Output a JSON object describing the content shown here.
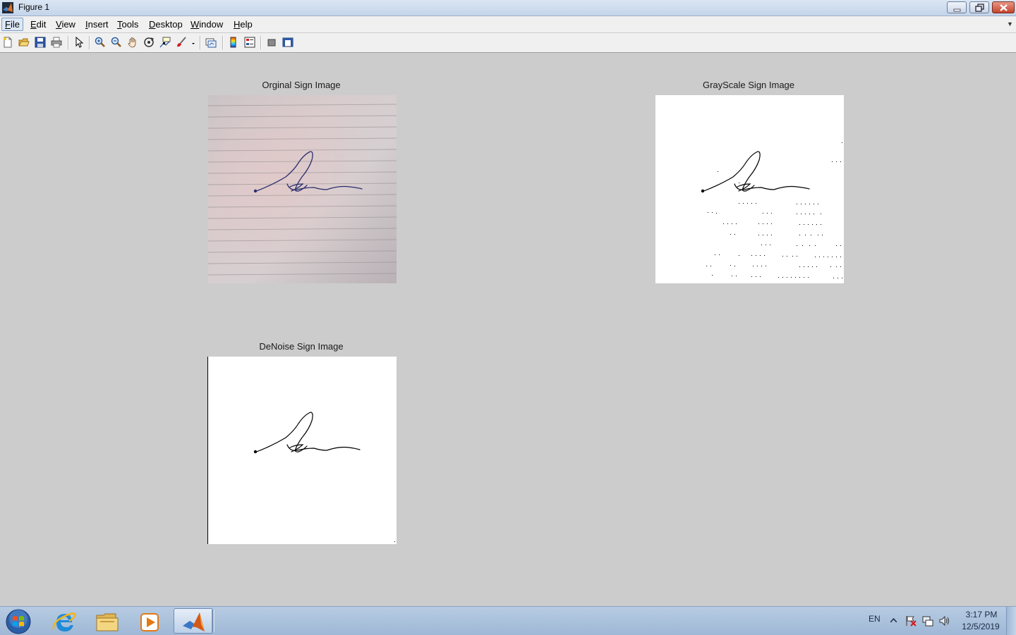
{
  "window": {
    "title": "Figure 1"
  },
  "menu": [
    {
      "label": "File",
      "ul": "F",
      "rest": "ile"
    },
    {
      "label": "Edit",
      "ul": "E",
      "rest": "dit"
    },
    {
      "label": "View",
      "ul": "V",
      "rest": "iew"
    },
    {
      "label": "Insert",
      "ul": "I",
      "rest": "nsert"
    },
    {
      "label": "Tools",
      "ul": "T",
      "rest": "ools"
    },
    {
      "label": "Desktop",
      "ul": "D",
      "rest": "esktop"
    },
    {
      "label": "Window",
      "ul": "W",
      "rest": "indow"
    },
    {
      "label": "Help",
      "ul": "H",
      "rest": "elp"
    }
  ],
  "toolbar": [
    "new-figure-icon",
    "open-file-icon",
    "save-icon",
    "print-icon",
    "edit-plot-arrow-icon",
    "zoom-in-icon",
    "zoom-out-icon",
    "pan-hand-icon",
    "rotate-3d-icon",
    "data-cursor-icon",
    "brush-icon",
    "link-plot-icon",
    "insert-colorbar-icon",
    "insert-legend-icon",
    "hide-plot-tools-icon",
    "show-plot-tools-icon"
  ],
  "axes": [
    {
      "title": "Orginal Sign Image"
    },
    {
      "title": "GrayScale Sign Image"
    },
    {
      "title": "DeNoise Sign Image"
    }
  ],
  "taskbar": {
    "apps": [
      "start-orb-icon",
      "internet-explorer-icon",
      "file-explorer-icon",
      "media-player-icon",
      "matlab-icon"
    ],
    "language": "EN",
    "time": "3:17 PM",
    "date": "12/5/2019"
  },
  "colors": {
    "ink": "#1a2a6e",
    "figure_bg": "#cccccc"
  }
}
